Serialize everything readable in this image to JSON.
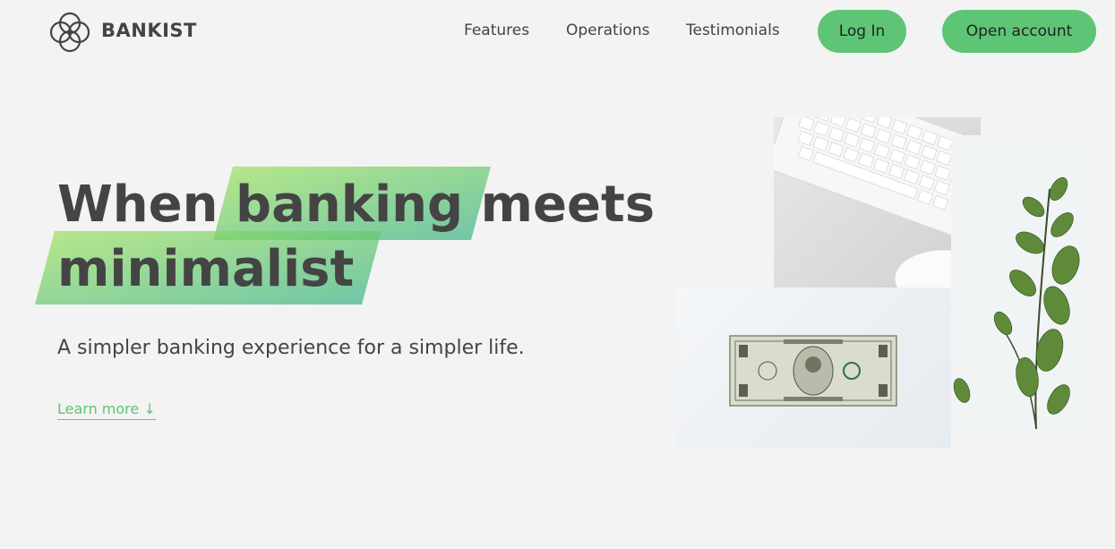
{
  "nav": {
    "brand": "BANKIST",
    "links": [
      "Features",
      "Operations",
      "Testimonials"
    ],
    "login_label": "Log In",
    "open_account_label": "Open account"
  },
  "hero": {
    "title_word1": "When",
    "title_highlight1": "banking",
    "title_word2": "meets",
    "title_highlight2": "minimalist",
    "subtitle": "A simpler banking experience for a simpler life.",
    "learn_more": "Learn more ↓"
  },
  "colors": {
    "accent": "#5ec576",
    "background": "#f3f3f3",
    "text": "#444444"
  },
  "icons": [
    "bankist-logo-icon"
  ],
  "images": [
    "keyboard-mouse-image",
    "dollar-bill-image",
    "plant-image"
  ]
}
